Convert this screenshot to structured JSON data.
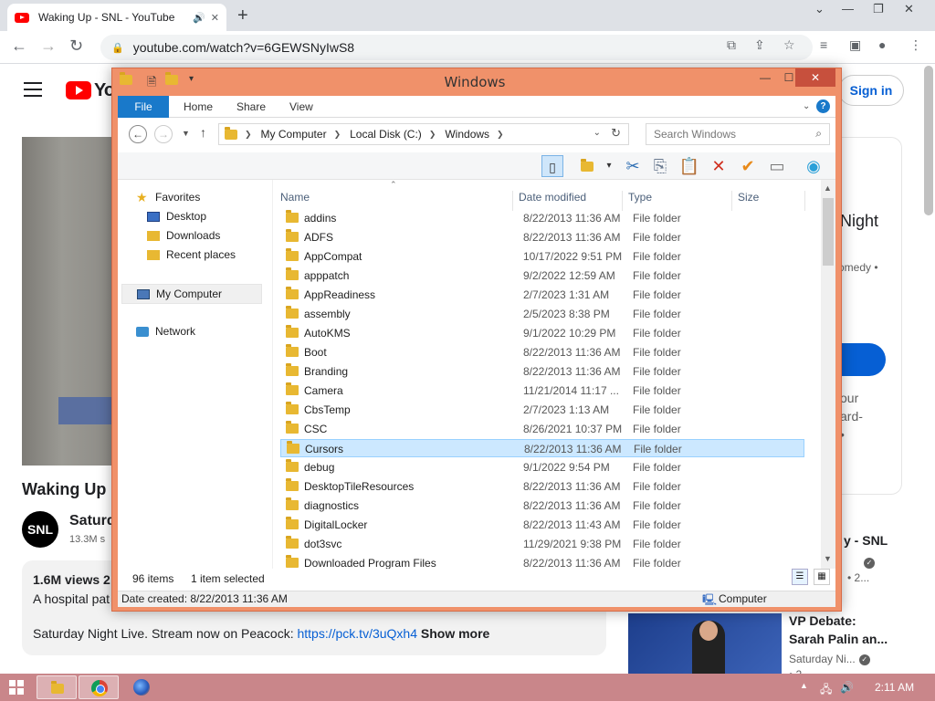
{
  "browser": {
    "tab_title": "Waking Up - SNL - YouTube",
    "tab_close": "✕",
    "new_tab": "+",
    "url": "youtube.com/watch?v=6GEWSNyIwS8"
  },
  "youtube": {
    "logo_text": "Yo",
    "sign_in": "Sign in",
    "video_title": "Waking Up",
    "channel_avatar": "SNL",
    "channel_name": "Saturd",
    "subs": "13.3M s",
    "views": "1.6M views  2",
    "desc_line1": "A hospital pat",
    "desc_line2_text": "Saturday Night Live. Stream now on Peacock: ",
    "desc_link": "https://pck.tv/3uQxh4",
    "show_more": "Show more",
    "right_night": "Night",
    "right_comedy": "omedy •",
    "right_text1": "our",
    "right_text2": "ard-",
    "right_text3": "•",
    "rel1_title": "y - SNL",
    "rel1_sub": "• 2...",
    "rel2_title1": "VP Debate:",
    "rel2_title2": "Sarah Palin an...",
    "rel2_channel": "Saturday Ni...",
    "rel2_sub": "• 2..."
  },
  "explorer": {
    "title": "Windows",
    "tabs": [
      "File",
      "Home",
      "Share",
      "View"
    ],
    "help": "?",
    "address": [
      "My Computer",
      "Local Disk (C:)",
      "Windows"
    ],
    "search_placeholder": "Search Windows",
    "nav": {
      "favorites": "Favorites",
      "desktop": "Desktop",
      "downloads": "Downloads",
      "recent": "Recent places",
      "computer": "My Computer",
      "network": "Network"
    },
    "columns": {
      "name": "Name",
      "date": "Date modified",
      "type": "Type",
      "size": "Size"
    },
    "files": [
      {
        "name": "addins",
        "date": "8/22/2013 11:36 AM",
        "type": "File folder"
      },
      {
        "name": "ADFS",
        "date": "8/22/2013 11:36 AM",
        "type": "File folder"
      },
      {
        "name": "AppCompat",
        "date": "10/17/2022 9:51 PM",
        "type": "File folder"
      },
      {
        "name": "apppatch",
        "date": "9/2/2022 12:59 AM",
        "type": "File folder"
      },
      {
        "name": "AppReadiness",
        "date": "2/7/2023 1:31 AM",
        "type": "File folder"
      },
      {
        "name": "assembly",
        "date": "2/5/2023 8:38 PM",
        "type": "File folder"
      },
      {
        "name": "AutoKMS",
        "date": "9/1/2022 10:29 PM",
        "type": "File folder"
      },
      {
        "name": "Boot",
        "date": "8/22/2013 11:36 AM",
        "type": "File folder"
      },
      {
        "name": "Branding",
        "date": "8/22/2013 11:36 AM",
        "type": "File folder"
      },
      {
        "name": "Camera",
        "date": "11/21/2014 11:17 ...",
        "type": "File folder"
      },
      {
        "name": "CbsTemp",
        "date": "2/7/2023 1:13 AM",
        "type": "File folder"
      },
      {
        "name": "CSC",
        "date": "8/26/2021 10:37 PM",
        "type": "File folder"
      },
      {
        "name": "Cursors",
        "date": "8/22/2013 11:36 AM",
        "type": "File folder"
      },
      {
        "name": "debug",
        "date": "9/1/2022 9:54 PM",
        "type": "File folder"
      },
      {
        "name": "DesktopTileResources",
        "date": "8/22/2013 11:36 AM",
        "type": "File folder"
      },
      {
        "name": "diagnostics",
        "date": "8/22/2013 11:36 AM",
        "type": "File folder"
      },
      {
        "name": "DigitalLocker",
        "date": "8/22/2013 11:43 AM",
        "type": "File folder"
      },
      {
        "name": "dot3svc",
        "date": "11/29/2021 9:38 PM",
        "type": "File folder"
      },
      {
        "name": "Downloaded Program Files",
        "date": "8/22/2013 11:36 AM",
        "type": "File folder"
      }
    ],
    "selected_index": 12,
    "item_count": "96 items",
    "selected_count": "1 item selected",
    "date_created": "Date created: 8/22/2013 11:36 AM",
    "location": "Computer"
  },
  "taskbar": {
    "clock": "2:11 AM"
  }
}
